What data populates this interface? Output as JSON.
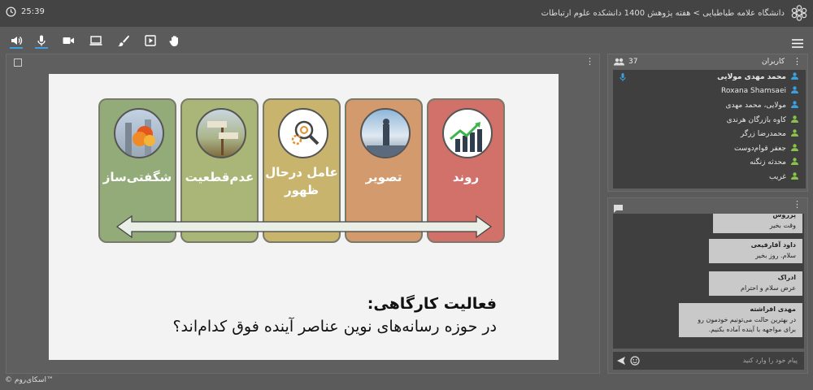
{
  "header": {
    "timer": "25:39",
    "title": "دانشگاه علامه طباطبایی > هفته پژوهش 1400 دانشکده علوم ارتباطات"
  },
  "toolbar": {
    "icons": [
      "speaker-icon",
      "microphone-icon",
      "camera-icon",
      "screen-share-icon",
      "brush-icon",
      "play-icon",
      "raise-hand-icon"
    ],
    "accent": "#3aa0e0"
  },
  "slide": {
    "cards": [
      {
        "label": "روند",
        "color": "#d2706a"
      },
      {
        "label": "تصویر",
        "color": "#d39a6e"
      },
      {
        "label": "عامل درحال ظهور",
        "color": "#c8b46c"
      },
      {
        "label": "عدم‌قطعیت",
        "color": "#a9b677"
      },
      {
        "label": "شگفتی‌ساز",
        "color": "#93ab78"
      }
    ],
    "activity_title": "فعالیت کارگاهی:",
    "activity_question": "در حوزه رسانه‌های نوین عناصر آینده فوق کدام‌اند؟"
  },
  "footer": {
    "brand": "© اسکای‌روم™"
  },
  "users_panel": {
    "count": "37",
    "title": "کاربران",
    "users": [
      {
        "name": "محمد مهدی مولایی",
        "bold": true,
        "mic": true,
        "color": "#3aa0e0"
      },
      {
        "name": "Roxana Shamsaei",
        "bold": false,
        "mic": false,
        "color": "#3aa0e0"
      },
      {
        "name": "مولایی، محمد مهدی",
        "bold": false,
        "mic": false,
        "color": "#3aa0e0"
      },
      {
        "name": "کاوه بازرگان هرندی",
        "bold": false,
        "mic": false,
        "color": "#8bc34a"
      },
      {
        "name": "محمدرضا زرگر",
        "bold": false,
        "mic": false,
        "color": "#8bc34a"
      },
      {
        "name": "جعفر قوام‌دوست",
        "bold": false,
        "mic": false,
        "color": "#8bc34a"
      },
      {
        "name": "محدثه زنگنه",
        "bold": false,
        "mic": false,
        "color": "#8bc34a"
      },
      {
        "name": "غریب",
        "bold": false,
        "mic": false,
        "color": "#8bc34a"
      }
    ]
  },
  "chat": {
    "messages": [
      {
        "author": "پرروس",
        "text": "وقت بخیر"
      },
      {
        "author": "داود آقارفیعی",
        "text": "سلام. روز بخیر"
      },
      {
        "author": "ادراک",
        "text": "عرض سلام و احترام"
      },
      {
        "author": "مهدی افراشته",
        "text": "در بهترین حالت می‌تونیم خودمون رو برای مواجهه با آینده آماده بکنیم."
      }
    ],
    "placeholder": "پیام خود را وارد کنید"
  }
}
